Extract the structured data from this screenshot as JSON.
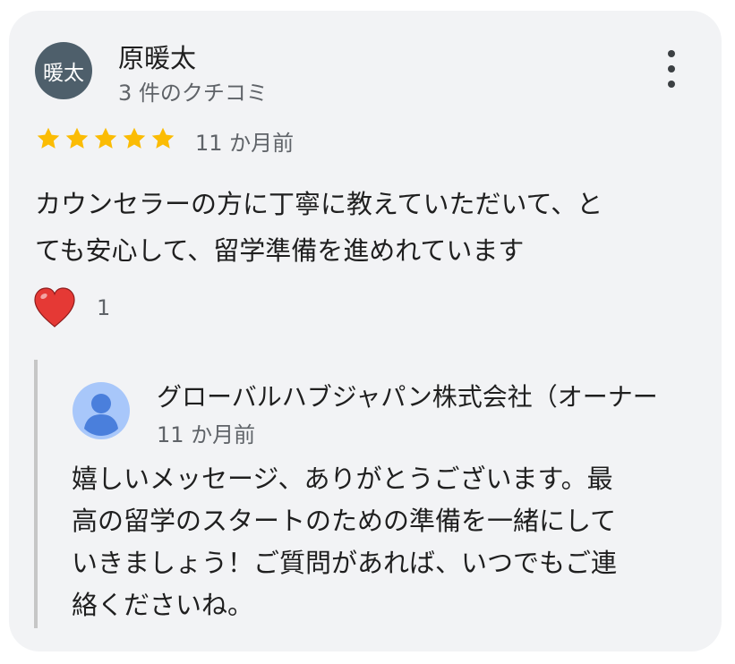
{
  "review": {
    "avatar_text": "暖太",
    "reviewer_name": "原暖太",
    "review_count": "3 件のクチコミ",
    "rating": 5,
    "rating_max": 5,
    "date": "11 か月前",
    "text_line1": "カウンセラーの方に丁寧に教えていただいて、と",
    "text_line2": "ても安心して、留学準備を進めれています",
    "reaction_count": "1"
  },
  "reply": {
    "owner_name": "グローバルハブジャパン株式会社（オーナー",
    "date": "11 か月前",
    "text_line1": "嬉しいメッセージ、ありがとうございます。最",
    "text_line2": "高の留学のスタートのための準備を一緒にして",
    "text_line3": "いきましょう！ご質問があれば、いつでもご連",
    "text_line4": "絡くださいね。"
  },
  "icons": {
    "menu": "more-vert-icon",
    "star": "star-icon",
    "reaction": "heart-icon",
    "owner_avatar": "default-person-icon"
  },
  "colors": {
    "card_bg": "#f2f3f5",
    "avatar_bg": "#4e5f6b",
    "star": "#fbbc04",
    "heart": "#e53935",
    "owner_avatar_bg": "#a8c7fa",
    "owner_avatar_fg": "#4a7fdc",
    "secondary_text": "#5f6368",
    "reply_bar": "#c6c6c6"
  }
}
